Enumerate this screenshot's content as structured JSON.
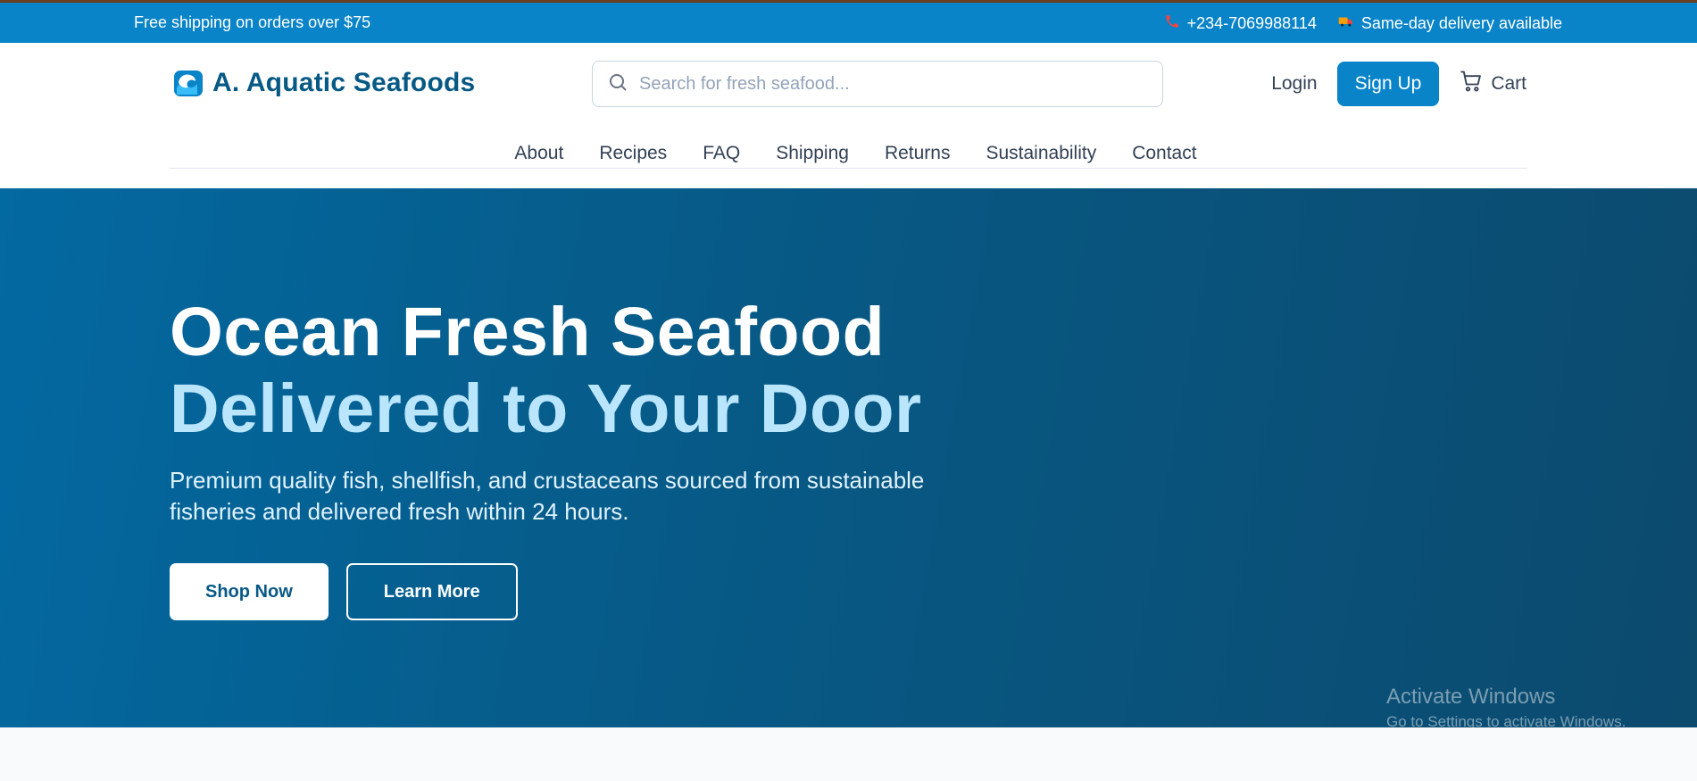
{
  "topbar": {
    "promo": "Free shipping on orders over $75",
    "phone": "+234-7069988114",
    "delivery": "Same-day delivery available",
    "phone_icon": "phone-icon",
    "delivery_icon": "truck-icon"
  },
  "header": {
    "brand_name": "A. Aquatic Seafoods",
    "logo_icon": "wave-icon",
    "search_placeholder": "Search for fresh seafood...",
    "login_label": "Login",
    "signup_label": "Sign Up",
    "cart_label": "Cart"
  },
  "nav": {
    "items": [
      "About",
      "Recipes",
      "FAQ",
      "Shipping",
      "Returns",
      "Sustainability",
      "Contact"
    ]
  },
  "hero": {
    "title_line1": "Ocean Fresh Seafood",
    "title_line2": "Delivered to Your Door",
    "subtitle": "Premium quality fish, shellfish, and crustaceans sourced from sustainable fisheries and delivered fresh within 24 hours.",
    "shop_label": "Shop Now",
    "learn_label": "Learn More"
  },
  "watermark": {
    "title": "Activate Windows",
    "subtitle": "Go to Settings to activate Windows."
  },
  "colors": {
    "accent": "#0a84c8",
    "brand": "#075985",
    "hero_highlight": "#bae6fd"
  }
}
